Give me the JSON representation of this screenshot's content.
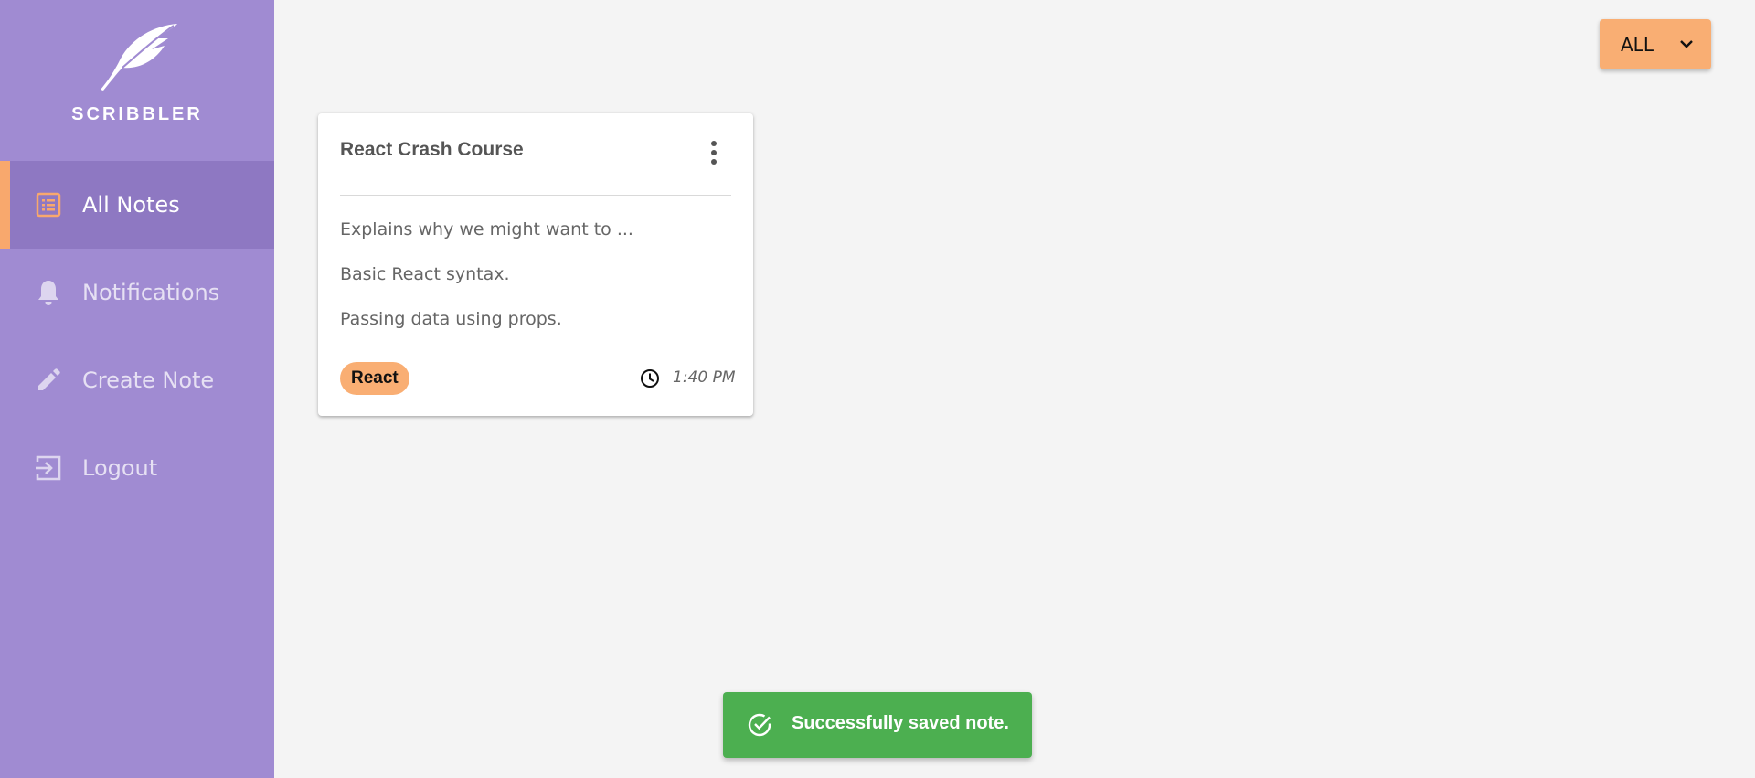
{
  "app": {
    "brand_name": "SCRIBBLER",
    "logo_icon": "feather-icon"
  },
  "sidebar": {
    "items": [
      {
        "label": "All Notes",
        "icon": "list-icon",
        "active": true
      },
      {
        "label": "Notifications",
        "icon": "bell-icon",
        "active": false
      },
      {
        "label": "Create Note",
        "icon": "pencil-icon",
        "active": false
      },
      {
        "label": "Logout",
        "icon": "logout-icon",
        "active": false
      }
    ]
  },
  "filter": {
    "selected": "ALL",
    "icon": "chevron-down-icon"
  },
  "notes": [
    {
      "title": "React Crash Course",
      "lines": [
        "Explains why we might want to ...",
        "Basic React syntax.",
        "Passing data using props."
      ],
      "tag": "React",
      "time": "1:40 PM"
    }
  ],
  "toast": {
    "message": "Successfully saved note.",
    "icon": "check-circle-icon"
  },
  "colors": {
    "sidebar_bg": "#a08bd2",
    "sidebar_active_bg": "#8e78c2",
    "accent": "#f9ae73",
    "page_bg": "#f4f4f4",
    "toast_bg": "#4caf50"
  }
}
